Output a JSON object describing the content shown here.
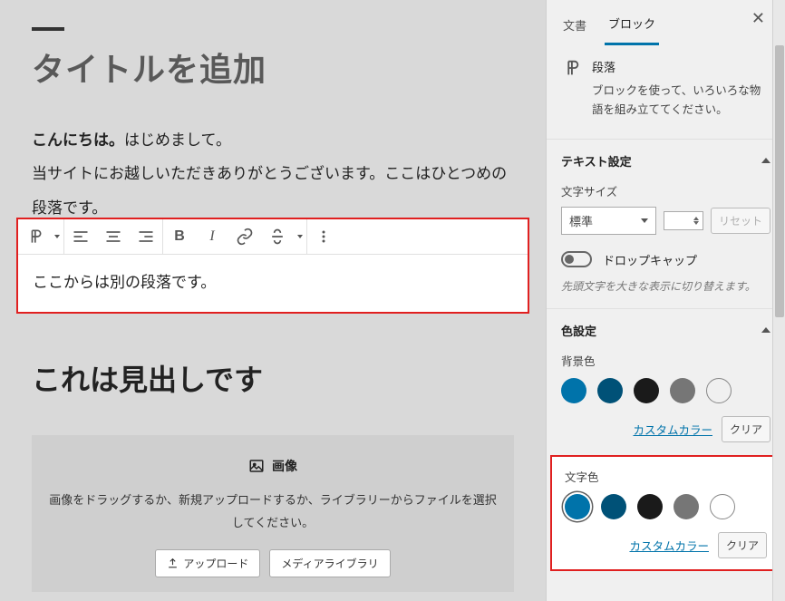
{
  "editor": {
    "title": "タイトルを追加",
    "para1_bold": "こんにちは。",
    "para1_rest": "はじめまして。",
    "para2": "当サイトにお越しいただきありがとうございます。ここはひとつめの段落です。",
    "selected_para": "ここからは別の段落です。",
    "heading2": "これは見出しです",
    "image_block": {
      "title": "画像",
      "desc": "画像をドラッグするか、新規アップロードするか、ライブラリーからファイルを選択してください。",
      "upload": "アップロード",
      "library": "メディアライブラリ"
    }
  },
  "sidebar": {
    "tab_document": "文書",
    "tab_block": "ブロック",
    "block_name": "段落",
    "block_desc": "ブロックを使って、いろいろな物語を組み立ててください。",
    "text_settings": "テキスト設定",
    "font_size_label": "文字サイズ",
    "font_size_value": "標準",
    "reset": "リセット",
    "dropcap_label": "ドロップキャップ",
    "dropcap_hint": "先頭文字を大きな表示に切り替えます。",
    "color_settings": "色設定",
    "bg_color": "背景色",
    "text_color": "文字色",
    "custom_color": "カスタムカラー",
    "clear": "クリア",
    "swatch_colors": [
      "#0073aa",
      "#005177",
      "#1a1a1a",
      "#767676"
    ]
  }
}
